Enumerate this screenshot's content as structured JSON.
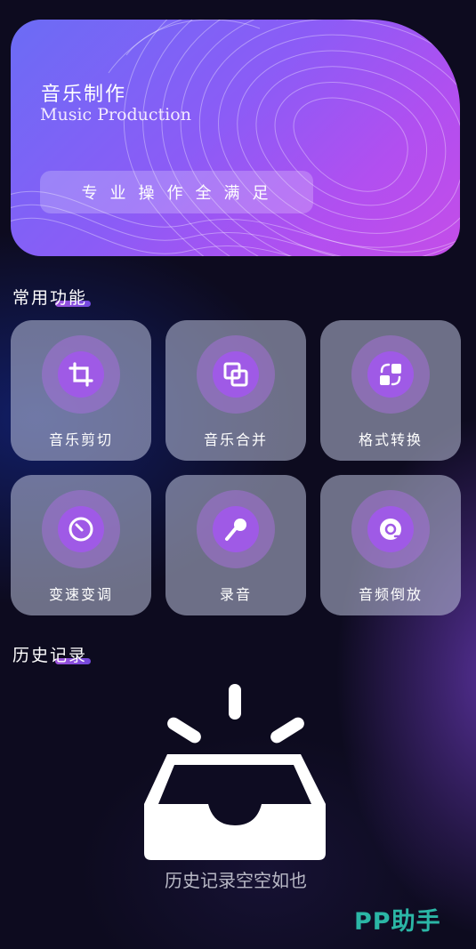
{
  "banner": {
    "title": "音乐制作",
    "subtitle": "Music Production",
    "tagline": "专业操作全满足"
  },
  "common_section": {
    "title": "常用功能"
  },
  "features": [
    {
      "label": "音乐剪切",
      "icon": "crop-icon"
    },
    {
      "label": "音乐合并",
      "icon": "merge-icon"
    },
    {
      "label": "格式转换",
      "icon": "convert-icon"
    },
    {
      "label": "变速变调",
      "icon": "speedometer-icon"
    },
    {
      "label": "录音",
      "icon": "microphone-icon"
    },
    {
      "label": "音频倒放",
      "icon": "vinyl-reverse-icon"
    }
  ],
  "history_section": {
    "title": "历史记录",
    "empty_text": "历史记录空空如也",
    "empty_icon": "empty-inbox-icon"
  },
  "watermark": "PP助手",
  "colors": {
    "accent": "#9f5ae6",
    "banner_start": "#6b6cf5",
    "banner_end": "#c44de8",
    "background": "#0d0b1f",
    "watermark": "#2bb6a6"
  }
}
